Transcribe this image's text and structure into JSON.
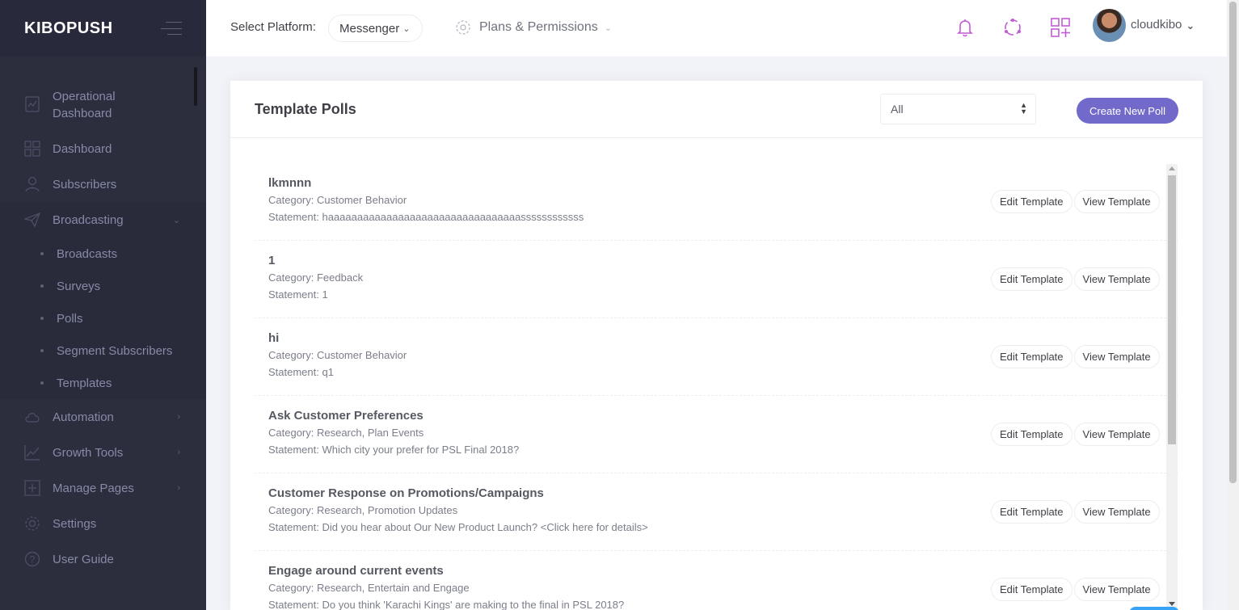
{
  "brand": "KIBOPUSH",
  "sidebar": {
    "items": [
      {
        "name": "operational-dashboard",
        "icon": "dashboard-icon",
        "label_line1": "Operational",
        "label_line2": "Dashboard"
      },
      {
        "name": "dashboard",
        "icon": "grid-icon",
        "label": "Dashboard"
      },
      {
        "name": "subscribers",
        "icon": "user-icon",
        "label": "Subscribers"
      },
      {
        "name": "broadcasting",
        "icon": "paper-plane-icon",
        "label": "Broadcasting"
      },
      {
        "name": "automation",
        "icon": "cloud-icon",
        "label": "Automation"
      },
      {
        "name": "growth-tools",
        "icon": "line-chart-icon",
        "label": "Growth Tools"
      },
      {
        "name": "manage-pages",
        "icon": "add-page-icon",
        "label": "Manage Pages"
      },
      {
        "name": "settings",
        "icon": "gear-icon",
        "label": "Settings"
      },
      {
        "name": "user-guide",
        "icon": "question-icon",
        "label": "User Guide"
      }
    ],
    "broadcasting_sub": [
      "Broadcasts",
      "Surveys",
      "Polls",
      "Segment Subscribers",
      "Templates"
    ]
  },
  "header": {
    "platform_label": "Select Platform:",
    "platform_value": "Messenger",
    "plans_label": "Plans & Permissions",
    "username": "cloudkibo",
    "accent_color": "#c15bd6"
  },
  "portlet": {
    "title": "Template Polls",
    "filter_value": "All",
    "create_button": "Create New Poll",
    "edit_label": "Edit Template",
    "view_label": "View Template"
  },
  "polls": [
    {
      "title": "lkmnnn",
      "category": "Category: Customer Behavior",
      "statement": "Statement: haaaaaaaaaaaaaaaaaaaaaaaaaaaaaaaaassssssssssss"
    },
    {
      "title": "1",
      "category": "Category: Feedback",
      "statement": "Statement: 1"
    },
    {
      "title": "hi",
      "category": "Category: Customer Behavior",
      "statement": "Statement: q1"
    },
    {
      "title": "Ask Customer Preferences",
      "category": "Category: Research, Plan Events",
      "statement": "Statement: Which city your prefer for PSL Final 2018?"
    },
    {
      "title": "Customer Response on Promotions/Campaigns",
      "category": "Category: Research, Promotion Updates",
      "statement": "Statement: Did you hear about Our New Product Launch? <Click here for details>"
    },
    {
      "title": "Engage around current events",
      "category": "Category: Research, Entertain and Engage",
      "statement": "Statement: Do you think 'Karachi Kings' are making to the final in PSL 2018?"
    }
  ]
}
